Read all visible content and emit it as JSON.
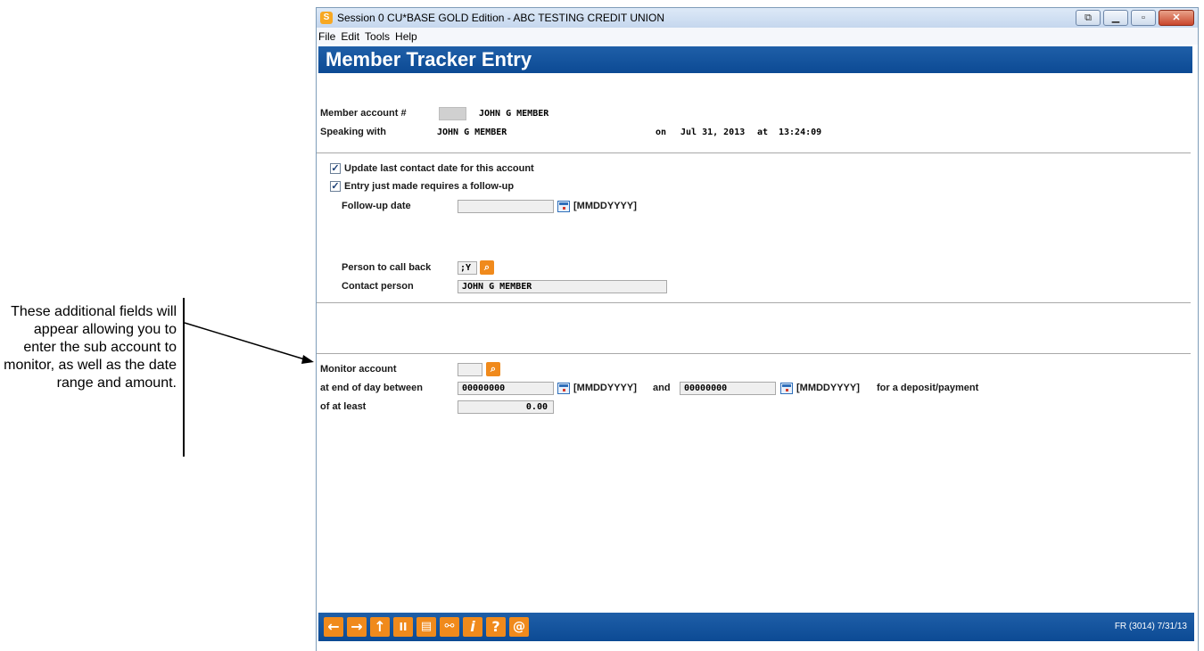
{
  "window": {
    "title": "Session 0 CU*BASE GOLD Edition - ABC TESTING CREDIT UNION",
    "menu": [
      "File",
      "Edit",
      "Tools",
      "Help"
    ]
  },
  "header": {
    "title": "Member Tracker Entry"
  },
  "member": {
    "account_label": "Member account #",
    "account_name": "JOHN G MEMBER",
    "speaking_label": "Speaking with",
    "speaking_name": "JOHN G MEMBER",
    "on_label": "on",
    "date": "Jul 31, 2013",
    "at_label": "at",
    "time": "13:24:09"
  },
  "options": {
    "update_contact_label": "Update last contact date for this account",
    "followup_required_label": "Entry just made requires a follow-up",
    "followup_date_label": "Follow-up date",
    "followup_date_value": "",
    "date_format": "[MMDDYYYY]"
  },
  "callback": {
    "person_label": "Person to call back",
    "person_value": ";Y",
    "contact_label": "Contact person",
    "contact_value": "JOHN G MEMBER"
  },
  "monitor": {
    "account_label": "Monitor account",
    "account_value": "",
    "between_label": "at end of day between",
    "start_date": "00000000",
    "date_format": "[MMDDYYYY]",
    "and_label": "and",
    "end_date": "00000000",
    "purpose_label": "for a deposit/payment",
    "least_label": "of at least",
    "amount": "0.00"
  },
  "toolbar": {
    "status": "FR (3014) 7/31/13"
  },
  "callout": {
    "text": "These additional fields will appear allowing you to enter the sub account to monitor, as well as the date range and amount."
  }
}
